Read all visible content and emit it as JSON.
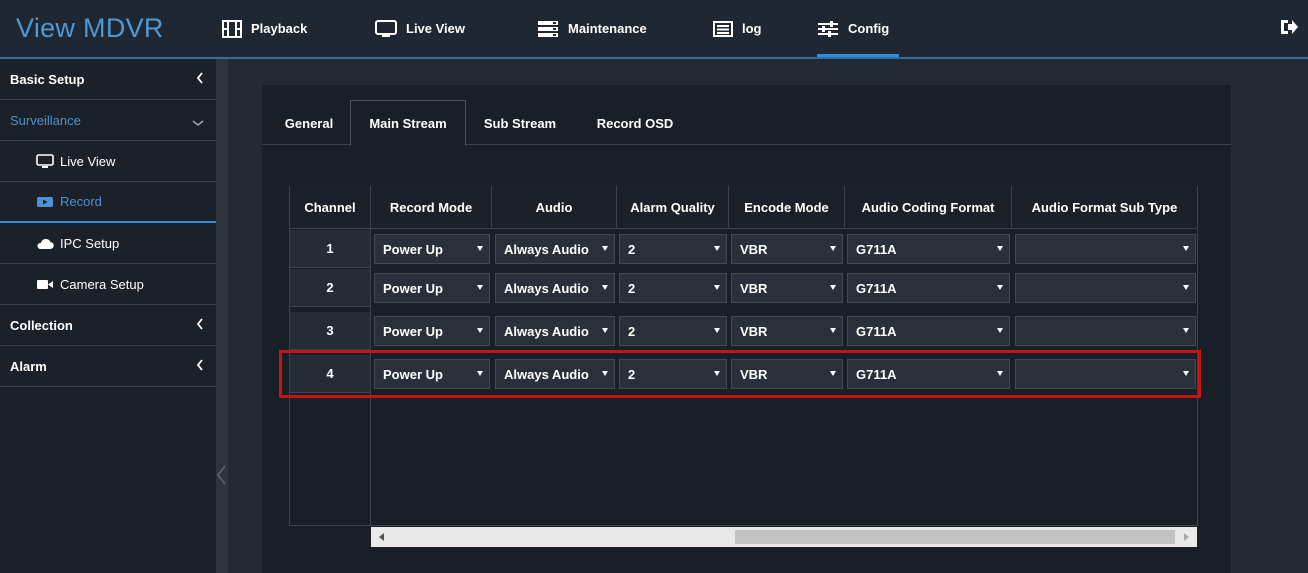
{
  "app": {
    "title": "View MDVR"
  },
  "nav": {
    "items": [
      {
        "label": "Playback",
        "icon": "film-icon"
      },
      {
        "label": "Live View",
        "icon": "monitor-icon"
      },
      {
        "label": "Maintenance",
        "icon": "server-icon"
      },
      {
        "label": "log",
        "icon": "log-list-icon"
      },
      {
        "label": "Config",
        "icon": "sliders-icon",
        "active": true
      }
    ],
    "logout_icon": "logout-icon"
  },
  "sidebar": {
    "basic_setup": "Basic Setup",
    "surveillance": "Surveillance",
    "live_view": "Live View",
    "record": "Record",
    "ipc_setup": "IPC Setup",
    "camera_setup": "Camera Setup",
    "collection": "Collection",
    "alarm": "Alarm"
  },
  "tabs": [
    "General",
    "Main Stream",
    "Sub Stream",
    "Record OSD"
  ],
  "active_tab": "Main Stream",
  "table": {
    "headers": [
      "Channel",
      "Record Mode",
      "Audio",
      "Alarm Quality",
      "Encode Mode",
      "Audio Coding Format",
      "Audio Format Sub Type"
    ],
    "rows": [
      {
        "channel": "1",
        "record_mode": "Power Up",
        "audio": "Always Audio",
        "alarm_quality": "2",
        "encode_mode": "VBR",
        "audio_coding": "G711A",
        "audio_sub_type": ""
      },
      {
        "channel": "2",
        "record_mode": "Power Up",
        "audio": "Always Audio",
        "alarm_quality": "2",
        "encode_mode": "VBR",
        "audio_coding": "G711A",
        "audio_sub_type": ""
      },
      {
        "channel": "3",
        "record_mode": "Power Up",
        "audio": "Always Audio",
        "alarm_quality": "2",
        "encode_mode": "VBR",
        "audio_coding": "G711A",
        "audio_sub_type": ""
      },
      {
        "channel": "4",
        "record_mode": "Power Up",
        "audio": "Always Audio",
        "alarm_quality": "2",
        "encode_mode": "VBR",
        "audio_coding": "G711A",
        "audio_sub_type": ""
      }
    ],
    "highlighted_row": 4
  },
  "colors": {
    "accent": "#2f8ee0",
    "brand": "#4f98d6",
    "highlight_border": "#c11518"
  }
}
